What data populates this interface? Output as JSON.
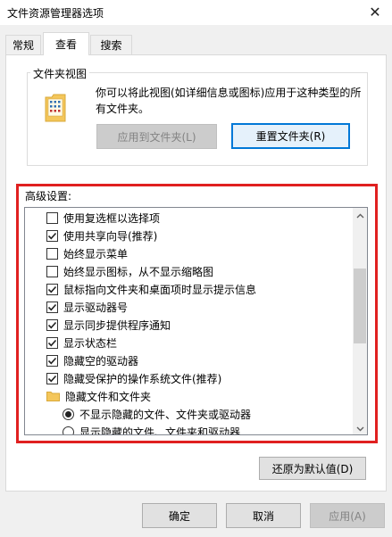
{
  "window": {
    "title": "文件资源管理器选项",
    "close_glyph": "✕"
  },
  "tabs": [
    {
      "label": "常规",
      "active": false
    },
    {
      "label": "查看",
      "active": true
    },
    {
      "label": "搜索",
      "active": false
    }
  ],
  "folder_views": {
    "title": "文件夹视图",
    "description": "你可以将此视图(如详细信息或图标)应用于这种类型的所有文件夹。",
    "apply_button": "应用到文件夹(L)",
    "reset_button": "重置文件夹(R)",
    "icon": "folder-view-icon"
  },
  "advanced": {
    "label": "高级设置:",
    "items": [
      {
        "type": "checkbox",
        "label": "使用复选框以选择项",
        "checked": false
      },
      {
        "type": "checkbox",
        "label": "使用共享向导(推荐)",
        "checked": true
      },
      {
        "type": "checkbox",
        "label": "始终显示菜单",
        "checked": false
      },
      {
        "type": "checkbox",
        "label": "始终显示图标，从不显示缩略图",
        "checked": false
      },
      {
        "type": "checkbox",
        "label": "鼠标指向文件夹和桌面项时显示提示信息",
        "checked": true
      },
      {
        "type": "checkbox",
        "label": "显示驱动器号",
        "checked": true
      },
      {
        "type": "checkbox",
        "label": "显示同步提供程序通知",
        "checked": true
      },
      {
        "type": "checkbox",
        "label": "显示状态栏",
        "checked": true
      },
      {
        "type": "checkbox",
        "label": "隐藏空的驱动器",
        "checked": true
      },
      {
        "type": "checkbox",
        "label": "隐藏受保护的操作系统文件(推荐)",
        "checked": true
      },
      {
        "type": "folder",
        "label": "隐藏文件和文件夹"
      },
      {
        "type": "radio",
        "label": "不显示隐藏的文件、文件夹或驱动器",
        "selected": true
      },
      {
        "type": "radio",
        "label": "显示隐藏的文件、文件夹和驱动器",
        "selected": false
      }
    ],
    "restore_button": "还原为默认值(D)"
  },
  "footer": {
    "ok": "确定",
    "cancel": "取消",
    "apply": "应用(A)"
  },
  "colors": {
    "highlight_border": "#e02020",
    "focus_border": "#0078d7",
    "folder_yellow": "#f4c65a"
  }
}
